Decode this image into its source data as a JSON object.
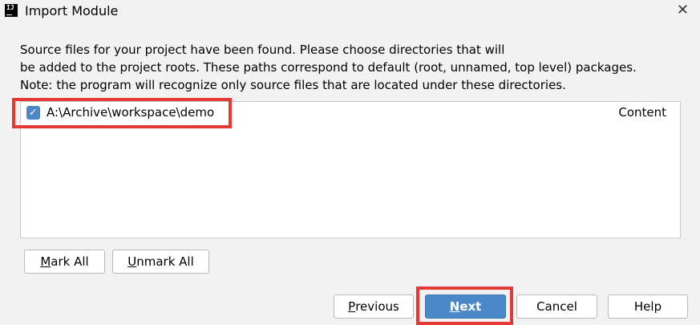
{
  "window": {
    "title": "Import Module",
    "app_icon_text": "IJ",
    "close_glyph": "✕"
  },
  "description": {
    "line1": "Source files for your project have been found. Please choose directories that will",
    "line2": "be added to the project roots. These paths correspond to default (root, unnamed, top level) packages.",
    "line3": "Note: the program will recognize only source files that are located under these directories."
  },
  "directories": [
    {
      "path": "A:\\Archive\\workspace\\demo",
      "type": "Content",
      "checked": true
    }
  ],
  "buttons": {
    "mark_all": {
      "mnemonic": "M",
      "rest": "ark All"
    },
    "unmark_all": {
      "mnemonic": "U",
      "rest": "nmark All"
    },
    "previous": {
      "mnemonic": "P",
      "rest": "revious"
    },
    "next": {
      "mnemonic": "N",
      "rest": "ext"
    },
    "cancel": "Cancel",
    "help": "Help"
  },
  "colors": {
    "accent": "#4a88c7",
    "highlight": "#e53935",
    "background": "#f2f2f2"
  }
}
